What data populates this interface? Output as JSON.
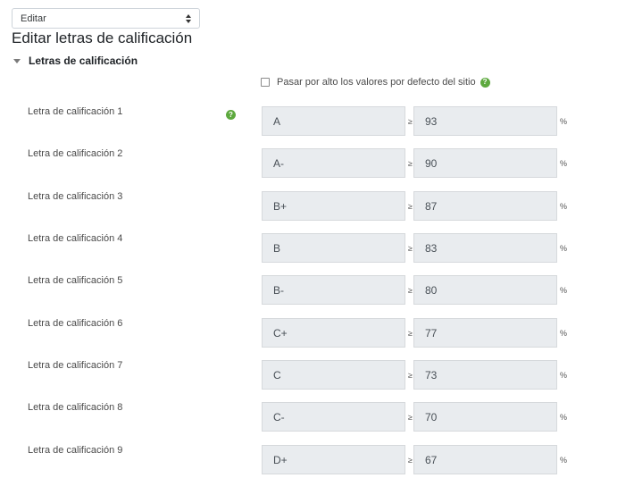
{
  "action_select": {
    "selected": "Editar"
  },
  "page_title": "Editar letras de calificación",
  "section": {
    "title": "Letras de calificación"
  },
  "override": {
    "label": "Pasar por alto los valores por defecto del sitio"
  },
  "help_symbol": "?",
  "geq_symbol": "≥",
  "percent_symbol": "%",
  "grade_letters": [
    {
      "label": "Letra de calificación 1",
      "letter": "A",
      "boundary": "93"
    },
    {
      "label": "Letra de calificación 2",
      "letter": "A-",
      "boundary": "90"
    },
    {
      "label": "Letra de calificación 3",
      "letter": "B+",
      "boundary": "87"
    },
    {
      "label": "Letra de calificación 4",
      "letter": "B",
      "boundary": "83"
    },
    {
      "label": "Letra de calificación 5",
      "letter": "B-",
      "boundary": "80"
    },
    {
      "label": "Letra de calificación 6",
      "letter": "C+",
      "boundary": "77"
    },
    {
      "label": "Letra de calificación 7",
      "letter": "C",
      "boundary": "73"
    },
    {
      "label": "Letra de calificación 8",
      "letter": "C-",
      "boundary": "70"
    },
    {
      "label": "Letra de calificación 9",
      "letter": "D+",
      "boundary": "67"
    }
  ]
}
